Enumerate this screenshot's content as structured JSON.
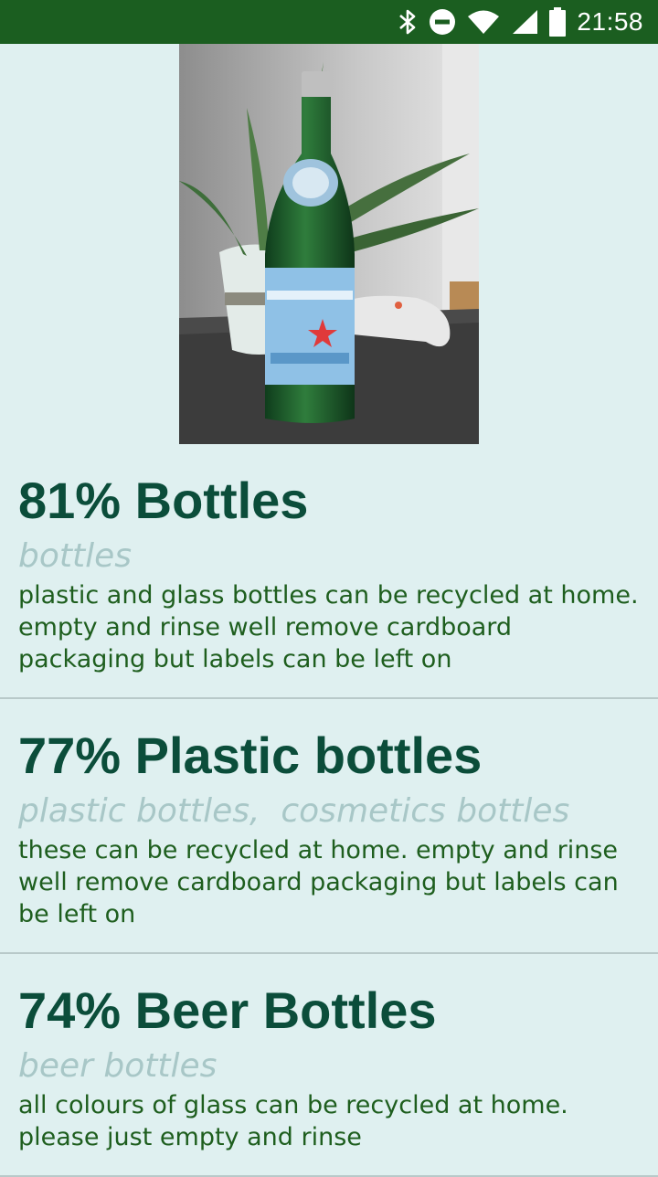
{
  "status_bar": {
    "time": "21:58",
    "icons": [
      "bluetooth-icon",
      "do-not-disturb-icon",
      "wifi-icon",
      "signal-icon",
      "battery-icon"
    ]
  },
  "photo": {
    "subject": "green-glass-bottle-photo"
  },
  "results": [
    {
      "title": "81% Bottles",
      "tags": "bottles",
      "description": "plastic and glass bottles can be recycled at home. empty and rinse well remove cardboard packaging but labels can be left on"
    },
    {
      "title": "77% Plastic bottles",
      "tags": "plastic bottles,  cosmetics bottles",
      "description": "these can be recycled at home. empty and rinse well remove cardboard packaging but labels can be left on"
    },
    {
      "title": "74% Beer Bottles",
      "tags": "beer bottles",
      "description": "all colours of glass can be recycled at home. please just empty and rinse"
    }
  ],
  "colors": {
    "status_bar": "#1b5e20",
    "background": "#dff0f0",
    "title": "#0b4d3a",
    "tags": "#a8c7c7",
    "description": "#1e5e1e"
  }
}
